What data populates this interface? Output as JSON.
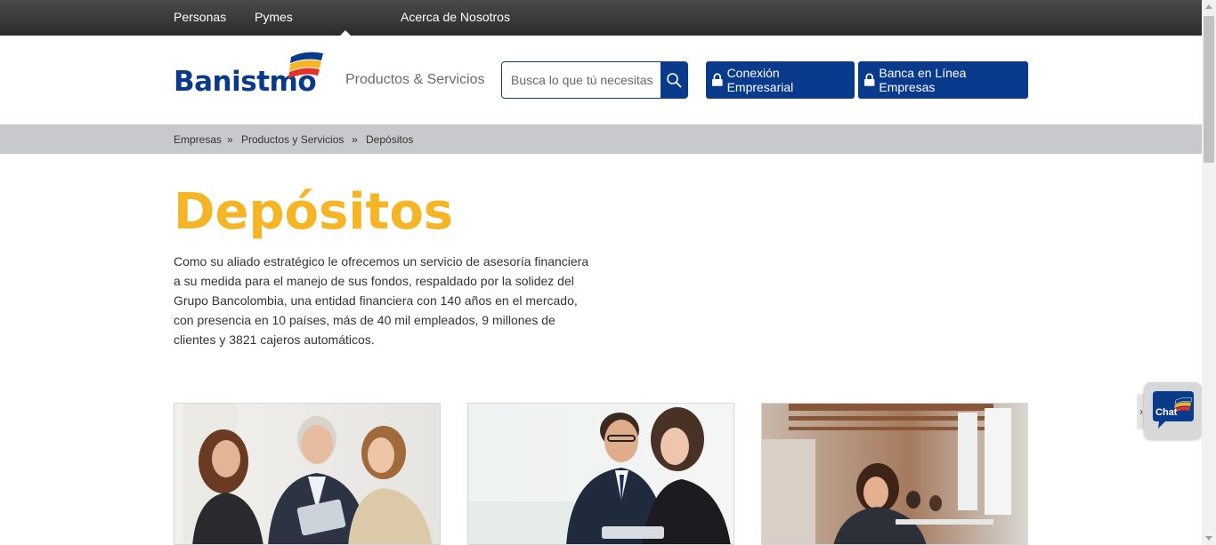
{
  "topnav": {
    "items": [
      "Personas",
      "Pymes",
      "Acerca de Nosotros"
    ]
  },
  "header": {
    "logo_text": "Banistmo",
    "products_link": "Productos & Servicios",
    "search_placeholder": "Busca lo que tú necesitas",
    "btn_conexion": "Conexión Empresarial",
    "btn_banca": "Banca en Línea Empresas"
  },
  "breadcrumb": {
    "items": [
      "Empresas",
      "Productos y Servicios",
      "Depósitos"
    ],
    "separator": "»"
  },
  "main": {
    "title": "Depósitos",
    "description": "Como su aliado estratégico le ofrecemos un servicio de asesoría financiera a su medida para el manejo de sus fondos, respaldado por la solidez del Grupo Bancolombia, una entidad financiera con 140 años en el mercado, con presencia en 10 países, más de 40 mil empleados, 9 millones de clientes y 3821 cajeros automáticos."
  },
  "chat": {
    "label": "Chat",
    "tab_glyph": "›"
  },
  "colors": {
    "brand_blue": "#0a3a8c",
    "brand_yellow": "#f5b524",
    "brand_red": "#e4312b",
    "topbar": "#333333",
    "breadcrumb_bg": "#c8c9cc"
  }
}
